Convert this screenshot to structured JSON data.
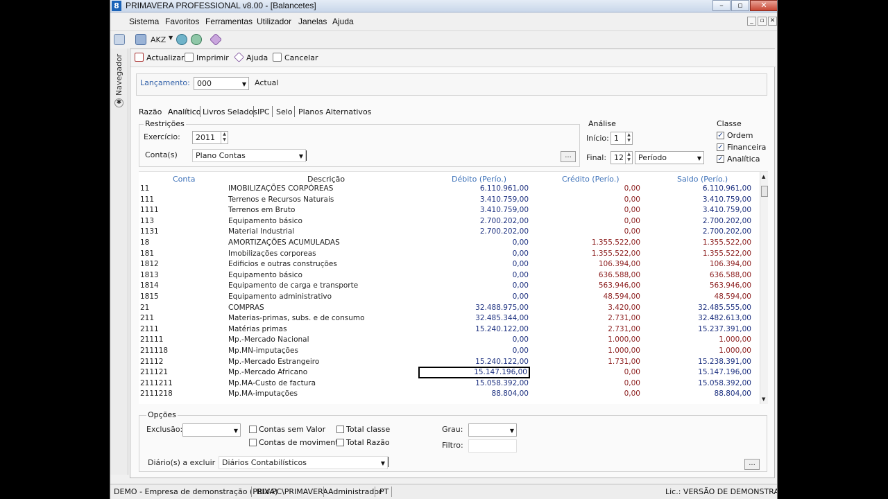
{
  "window": {
    "title": "PRIMAVERA PROFESSIONAL v8.00 - [Balancetes]",
    "app_icon_text": "8"
  },
  "menu": [
    "Sistema",
    "Favoritos",
    "Ferramentas",
    "Utilizador",
    "Janelas",
    "Ajuda"
  ],
  "toolbar1": {
    "currency": "AKZ"
  },
  "navigator_label": "Navegador",
  "toolbar2": {
    "actualizar": "Actualizar",
    "imprimir": "Imprimir",
    "ajuda": "Ajuda",
    "cancelar": "Cancelar"
  },
  "lancamento": {
    "label": "Lançamento:",
    "value": "000",
    "desc": "Actual"
  },
  "tabs": [
    "Razão",
    "Analítico",
    "Livros Selados",
    "IPC",
    "Selo",
    "Planos Alternativos"
  ],
  "restricoes": {
    "title": "Restrições",
    "exercicio_label": "Exercício:",
    "exercicio_value": "2011",
    "contas_label": "Conta(s)",
    "contas_value": "Plano Contas",
    "ellipsis": "..."
  },
  "analise": {
    "title": "Análise",
    "inicio_label": "Início:",
    "inicio_value": "1",
    "final_label": "Final:",
    "final_value": "12",
    "periodo_value": "Período"
  },
  "classe": {
    "title": "Classe",
    "items": [
      {
        "label": "Ordem",
        "checked": true
      },
      {
        "label": "Financeira",
        "checked": true
      },
      {
        "label": "Analítica",
        "checked": true
      }
    ]
  },
  "grid": {
    "headers": {
      "conta": "Conta",
      "descricao": "Descrição",
      "debito": "Débito (Perío.)",
      "credito": "Crédito (Perío.)",
      "saldo": "Saldo (Perío.)"
    },
    "rows": [
      {
        "conta": "11",
        "descricao": "IMOBILIZAÇÕES CORPÓREAS",
        "debito": "6.110.961,00",
        "credito": "0,00",
        "saldo": "6.110.961,00",
        "saldo_pos": true
      },
      {
        "conta": "111",
        "descricao": "Terrenos e Recursos Naturais",
        "debito": "3.410.759,00",
        "credito": "0,00",
        "saldo": "3.410.759,00",
        "saldo_pos": true
      },
      {
        "conta": "1111",
        "descricao": "Terrenos em Bruto",
        "debito": "3.410.759,00",
        "credito": "0,00",
        "saldo": "3.410.759,00",
        "saldo_pos": true
      },
      {
        "conta": "113",
        "descricao": "Equipamento básico",
        "debito": "2.700.202,00",
        "credito": "0,00",
        "saldo": "2.700.202,00",
        "saldo_pos": true
      },
      {
        "conta": "1131",
        "descricao": "Material Industrial",
        "debito": "2.700.202,00",
        "credito": "0,00",
        "saldo": "2.700.202,00",
        "saldo_pos": true
      },
      {
        "conta": "18",
        "descricao": "AMORTIZAÇÕES ACUMULADAS",
        "debito": "0,00",
        "credito": "1.355.522,00",
        "saldo": "1.355.522,00",
        "saldo_pos": false
      },
      {
        "conta": "181",
        "descricao": "Imobilizações corporeas",
        "debito": "0,00",
        "credito": "1.355.522,00",
        "saldo": "1.355.522,00",
        "saldo_pos": false
      },
      {
        "conta": "1812",
        "descricao": "Edificios e outras construções",
        "debito": "0,00",
        "credito": "106.394,00",
        "saldo": "106.394,00",
        "saldo_pos": false
      },
      {
        "conta": "1813",
        "descricao": "Equipamento básico",
        "debito": "0,00",
        "credito": "636.588,00",
        "saldo": "636.588,00",
        "saldo_pos": false
      },
      {
        "conta": "1814",
        "descricao": "Equipamento de carga e transporte",
        "debito": "0,00",
        "credito": "563.946,00",
        "saldo": "563.946,00",
        "saldo_pos": false
      },
      {
        "conta": "1815",
        "descricao": "Equipamento administrativo",
        "debito": "0,00",
        "credito": "48.594,00",
        "saldo": "48.594,00",
        "saldo_pos": false
      },
      {
        "conta": "21",
        "descricao": "COMPRAS",
        "debito": "32.488.975,00",
        "credito": "3.420,00",
        "saldo": "32.485.555,00",
        "saldo_pos": true
      },
      {
        "conta": "211",
        "descricao": "Materias-primas, subs. e de consumo",
        "debito": "32.485.344,00",
        "credito": "2.731,00",
        "saldo": "32.482.613,00",
        "saldo_pos": true
      },
      {
        "conta": "2111",
        "descricao": "Matérias primas",
        "debito": "15.240.122,00",
        "credito": "2.731,00",
        "saldo": "15.237.391,00",
        "saldo_pos": true
      },
      {
        "conta": "21111",
        "descricao": "Mp.-Mercado Nacional",
        "debito": "0,00",
        "credito": "1.000,00",
        "saldo": "1.000,00",
        "saldo_pos": false
      },
      {
        "conta": "211118",
        "descricao": "Mp.MN-imputações",
        "debito": "0,00",
        "credito": "1.000,00",
        "saldo": "1.000,00",
        "saldo_pos": false
      },
      {
        "conta": "21112",
        "descricao": "Mp.-Mercado Estrangeiro",
        "debito": "15.240.122,00",
        "credito": "1.731,00",
        "saldo": "15.238.391,00",
        "saldo_pos": true
      },
      {
        "conta": "211121",
        "descricao": "Mp.-Mercado Africano",
        "debito": "15.147.196,00",
        "credito": "0,00",
        "saldo": "15.147.196,00",
        "saldo_pos": true,
        "selected": true
      },
      {
        "conta": "2111211",
        "descricao": "Mp.MA-Custo de factura",
        "debito": "15.058.392,00",
        "credito": "0,00",
        "saldo": "15.058.392,00",
        "saldo_pos": true
      },
      {
        "conta": "2111218",
        "descricao": "Mp.MA-imputações",
        "debito": "88.804,00",
        "credito": "0,00",
        "saldo": "88.804,00",
        "saldo_pos": true
      }
    ]
  },
  "opcoes": {
    "title": "Opções",
    "exclusao_label": "Exclusão:",
    "contas_sem_valor": "Contas sem Valor",
    "contas_de_movimento": "Contas de movimento",
    "total_classe": "Total classe",
    "total_razao": "Total Razão",
    "grau_label": "Grau:",
    "filtro_label": "Filtro:",
    "diarios_label": "Diário(s) a excluir",
    "diarios_value": "Diários Contabilísticos",
    "ellipsis": "..."
  },
  "status": {
    "empresa": "DEMO - Empresa de demonstração (PRIVA)",
    "server": "BIX-PC\\PRIMAVERA",
    "user": "Administrador",
    "lang": "PT",
    "licence": "Lic.: VERSÃO DE DEMONSTRAÇÃO"
  },
  "colors": {
    "debit": "#1b2f7f",
    "credit": "#8c1d1d",
    "header": "#3b70b8"
  }
}
